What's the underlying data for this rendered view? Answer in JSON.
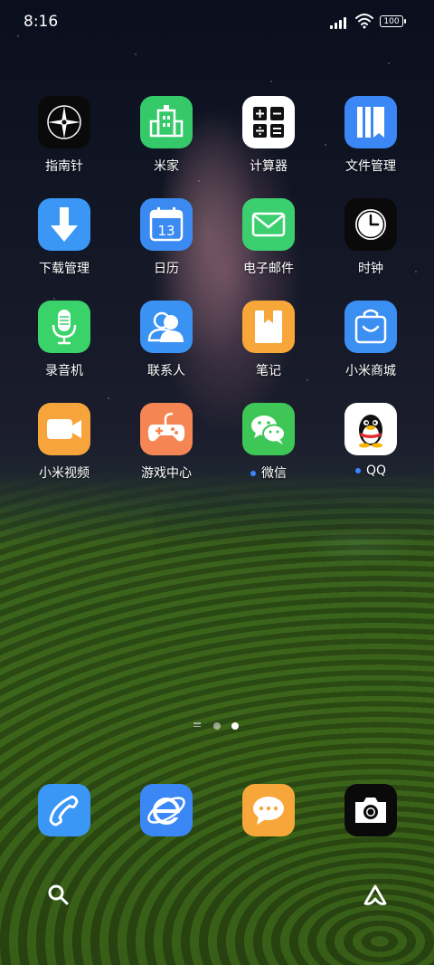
{
  "status_bar": {
    "time": "8:16",
    "battery": "100",
    "icons": [
      "signal-icon",
      "wifi-icon",
      "battery-icon"
    ]
  },
  "apps": [
    {
      "label": "指南针",
      "icon": "compass-icon",
      "bg": "#0a0a0a"
    },
    {
      "label": "米家",
      "icon": "mijia-building-icon",
      "bg": "#35c96a"
    },
    {
      "label": "计算器",
      "icon": "calculator-icon",
      "bg": "#ffffff"
    },
    {
      "label": "文件管理",
      "icon": "file-manager-icon",
      "bg": "#3a87f5"
    },
    {
      "label": "下载管理",
      "icon": "download-arrow-icon",
      "bg": "#3a97f5"
    },
    {
      "label": "日历",
      "icon": "calendar-icon",
      "bg": "#3b8af2",
      "calendar_day": "13"
    },
    {
      "label": "电子邮件",
      "icon": "mail-icon",
      "bg": "#3ccf6f"
    },
    {
      "label": "时钟",
      "icon": "clock-icon",
      "bg": "#0a0a0a"
    },
    {
      "label": "录音机",
      "icon": "microphone-icon",
      "bg": "#39d36a"
    },
    {
      "label": "联系人",
      "icon": "contacts-icon",
      "bg": "#3a92f3"
    },
    {
      "label": "笔记",
      "icon": "notes-icon",
      "bg": "#f7a739"
    },
    {
      "label": "小米商城",
      "icon": "shopping-bag-icon",
      "bg": "#3b8ef2"
    },
    {
      "label": "小米视频",
      "icon": "video-camera-icon",
      "bg": "#f8a43c"
    },
    {
      "label": "游戏中心",
      "icon": "gamepad-icon",
      "bg": "#f58552"
    },
    {
      "label": "微信",
      "icon": "wechat-icon",
      "bg": "#3ec757",
      "new_dot": true
    },
    {
      "label": "QQ",
      "icon": "qq-penguin-icon",
      "bg": "#ffffff",
      "new_dot": true
    }
  ],
  "pager": {
    "pages": 2,
    "current": 2
  },
  "dock": [
    {
      "icon": "phone-icon",
      "bg": "#3a97f5"
    },
    {
      "icon": "browser-icon",
      "bg": "#3a87f5"
    },
    {
      "icon": "messages-icon",
      "bg": "#f7a739"
    },
    {
      "icon": "camera-icon",
      "bg": "#0a0a0a"
    }
  ],
  "bottom": {
    "left_icon": "search-icon",
    "right_icon": "assistant-icon"
  }
}
